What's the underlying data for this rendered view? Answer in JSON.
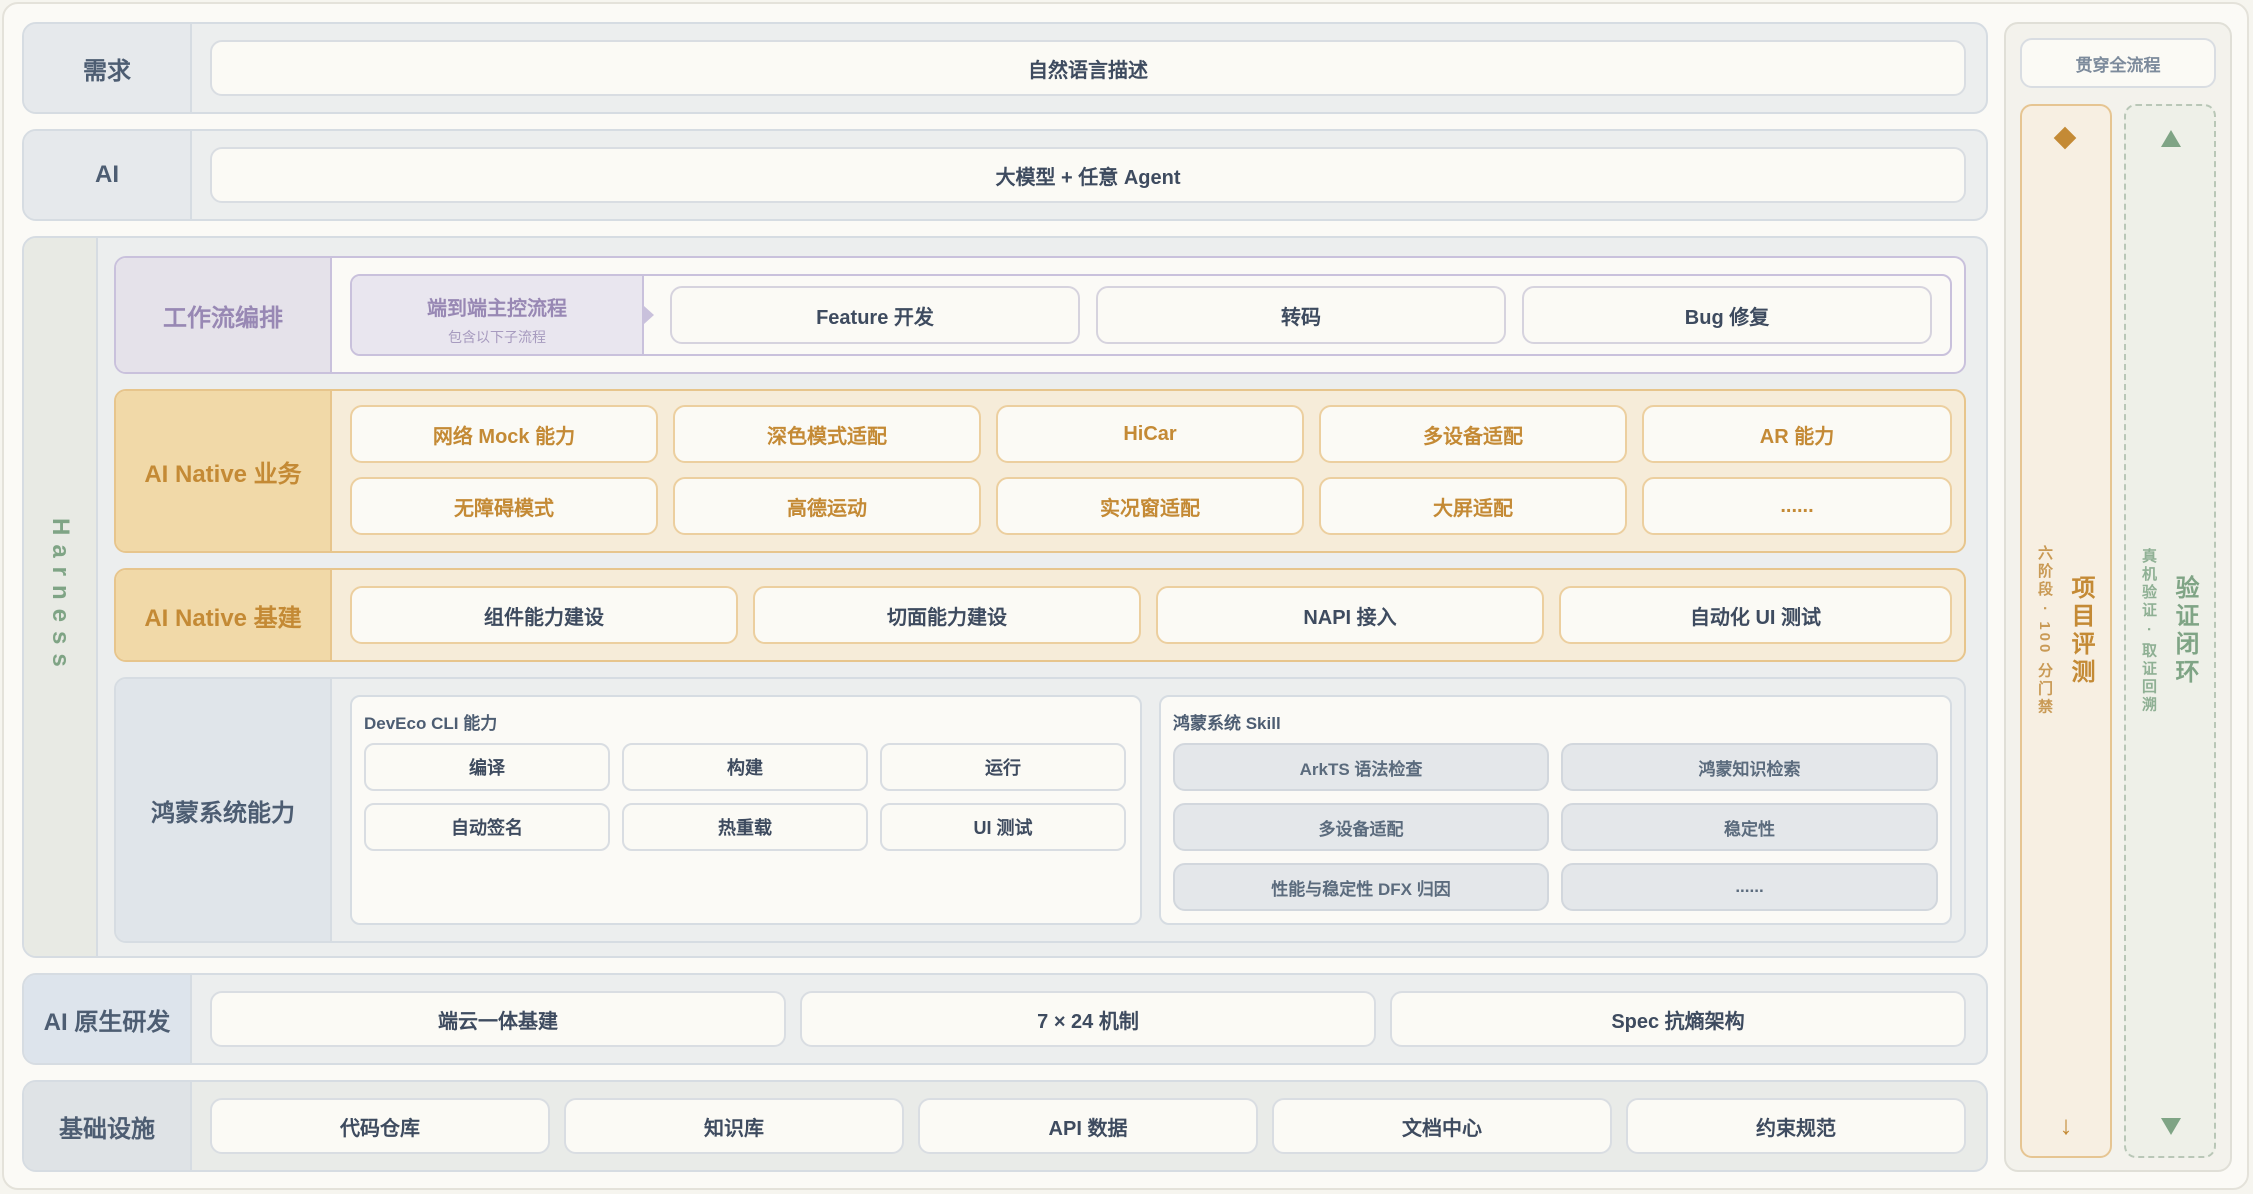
{
  "rows": {
    "demand": {
      "label": "需求",
      "content": "自然语言描述"
    },
    "ai": {
      "label": "AI",
      "content": "大模型 + 任意 Agent"
    },
    "native_dev": {
      "label": "AI 原生研发",
      "items": [
        "端云一体基建",
        "7 × 24 机制",
        "Spec 抗熵架构"
      ]
    },
    "infra": {
      "label": "基础设施",
      "items": [
        "代码仓库",
        "知识库",
        "API 数据",
        "文档中心",
        "约束规范"
      ]
    }
  },
  "harness": {
    "label": "Harness",
    "workflow": {
      "label": "工作流编排",
      "main_title": "端到端主控流程",
      "main_sub": "包含以下子流程",
      "items": [
        "Feature 开发",
        "转码",
        "Bug 修复"
      ]
    },
    "business": {
      "label": "AI Native 业务",
      "items": [
        "网络 Mock 能力",
        "深色模式适配",
        "HiCar",
        "多设备适配",
        "AR 能力",
        "无障碍模式",
        "高德运动",
        "实况窗适配",
        "大屏适配",
        "......"
      ]
    },
    "base": {
      "label": "AI Native 基建",
      "items": [
        "组件能力建设",
        "切面能力建设",
        "NAPI 接入",
        "自动化 UI 测试"
      ]
    },
    "harmony": {
      "label": "鸿蒙系统能力",
      "cli_title": "DevEco CLI 能力",
      "cli_items": [
        "编译",
        "构建",
        "运行",
        "自动签名",
        "热重载",
        "UI 测试"
      ],
      "skill_title": "鸿蒙系统 Skill",
      "skill_items": [
        "ArkTS 语法检查",
        "鸿蒙知识检索",
        "多设备适配",
        "稳定性",
        "性能与稳定性 DFX 归因",
        "......"
      ]
    }
  },
  "side": {
    "header": "贯穿全流程",
    "eval": {
      "title": "项目评测",
      "sub": "六阶段 · 100 分门禁",
      "top_icon": "diamond-icon",
      "bottom_icon": "arrow-down-icon"
    },
    "verify": {
      "title": "验证闭环",
      "sub": "真机验证 · 取证回溯",
      "top_icon": "triangle-up-icon",
      "bottom_icon": "triangle-down-icon"
    }
  },
  "colors": {
    "workflow": "#9888b4",
    "orange": "#c48a35",
    "green": "#7fa485",
    "slate": "#4d5d72"
  }
}
